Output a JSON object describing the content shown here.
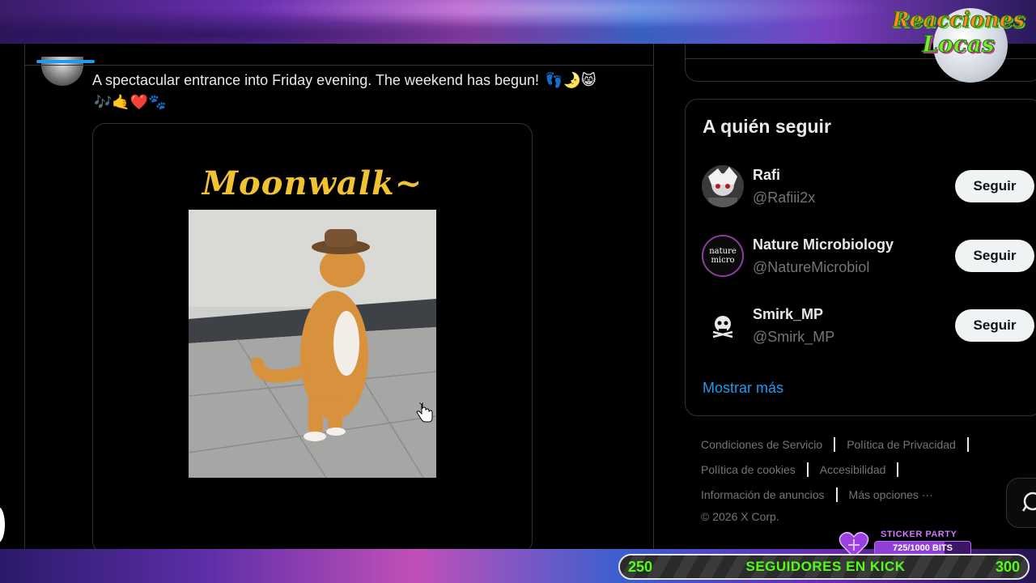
{
  "branding": {
    "logo_line1": "Reacciones",
    "logo_line2": "Locas"
  },
  "tweet": {
    "text": "A spectacular entrance into Friday evening. The weekend has begun!",
    "emojis_line1": "👣🌛😸",
    "emojis_line2": "🎶🤙❤️🐾",
    "media_title": "Moonwalk~"
  },
  "who_to_follow": {
    "title": "A quién seguir",
    "users": [
      {
        "name": "Rafi",
        "handle": "@Rafiii2x",
        "button": "Seguir"
      },
      {
        "name": "Nature Microbiology",
        "handle": "@NatureMicrobiol",
        "button": "Seguir",
        "avatar_text_1": "nature",
        "avatar_text_2": "micro"
      },
      {
        "name": "Smirk_MP",
        "handle": "@Smirk_MP",
        "button": "Seguir"
      }
    ],
    "show_more": "Mostrar más"
  },
  "footer": {
    "links": [
      "Condiciones de Servicio",
      "Política de Privacidad",
      "Política de cookies",
      "Accesibilidad",
      "Información de anuncios",
      "Más opciones ···"
    ],
    "copyright": "© 2026 X Corp."
  },
  "stream_overlay": {
    "sticker_title": "STICKER PARTY",
    "sticker_progress": "725/1000 BITS",
    "sticker_fraction": 0.725,
    "kick_start": "250",
    "kick_label": "SEGUIDORES EN KICK",
    "kick_end": "300",
    "colors": {
      "kick_accent": "#53fc18",
      "link_blue": "#1d9bf0"
    }
  }
}
